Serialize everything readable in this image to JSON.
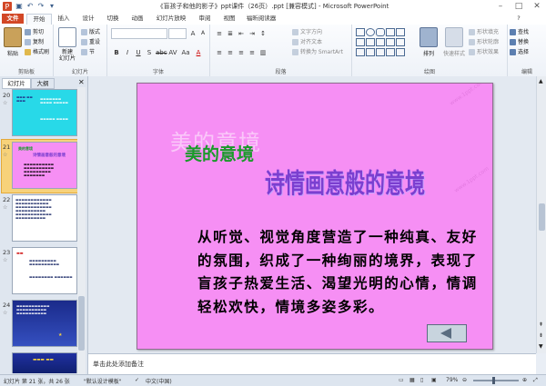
{
  "window": {
    "title": "《盲孩子和他的影子》ppt课件（26页）.ppt [兼容模式] - Microsoft PowerPoint"
  },
  "tabs": [
    "文件",
    "开始",
    "插入",
    "设计",
    "切换",
    "动画",
    "幻灯片放映",
    "审阅",
    "视图",
    "福昕阅读器"
  ],
  "ribbon": {
    "clipboard": {
      "paste": "粘贴",
      "cut": "剪切",
      "copy": "复制",
      "format_painter": "格式刷",
      "label": "剪贴板"
    },
    "slides": {
      "new_slide": "新建\n幻灯片",
      "layout": "版式",
      "reset": "重设",
      "section": "节",
      "label": "幻灯片"
    },
    "font": {
      "label": "字体"
    },
    "paragraph": {
      "text_direction": "文字方向",
      "align_text": "对齐文本",
      "smartart": "转换为 SmartArt",
      "label": "段落"
    },
    "drawing": {
      "arrange": "排列",
      "quick_styles": "快速样式",
      "shape_fill": "形状填充",
      "shape_outline": "形状轮廓",
      "shape_effects": "形状效果",
      "label": "绘图"
    },
    "editing": {
      "find": "查找",
      "replace": "替换",
      "select": "选择",
      "label": "编辑"
    }
  },
  "panel": {
    "tabs": [
      "幻灯片",
      "大纲"
    ],
    "thumbnails": [
      {
        "num": "20",
        "star": "☆"
      },
      {
        "num": "21",
        "star": "☆"
      },
      {
        "num": "22",
        "star": "☆"
      },
      {
        "num": "23",
        "star": "☆"
      },
      {
        "num": "24",
        "star": "☆"
      }
    ]
  },
  "slide": {
    "shadow_title": "美的意境",
    "title": "美的意境",
    "subtitle": "诗情画意般的意境",
    "body": "从听觉、视觉角度营造了一种纯真、友好的氛围，织成了一种绚丽的境界，表现了盲孩子热爱生活、渴望光明的心情，情调轻松欢快，情境多姿多彩。"
  },
  "notes": {
    "placeholder": "单击此处添加备注"
  },
  "status": {
    "slide_info": "幻灯片 第 21 张，共 26 张",
    "theme": "\"默认设计模板\"",
    "language": "中文(中国)",
    "zoom": "79%"
  },
  "colors": {
    "file_tab": "#d24726",
    "slide_bg": "#f68ff4",
    "title_green": "#1a9a2a",
    "subtitle_purple": "#7b3fd0"
  }
}
